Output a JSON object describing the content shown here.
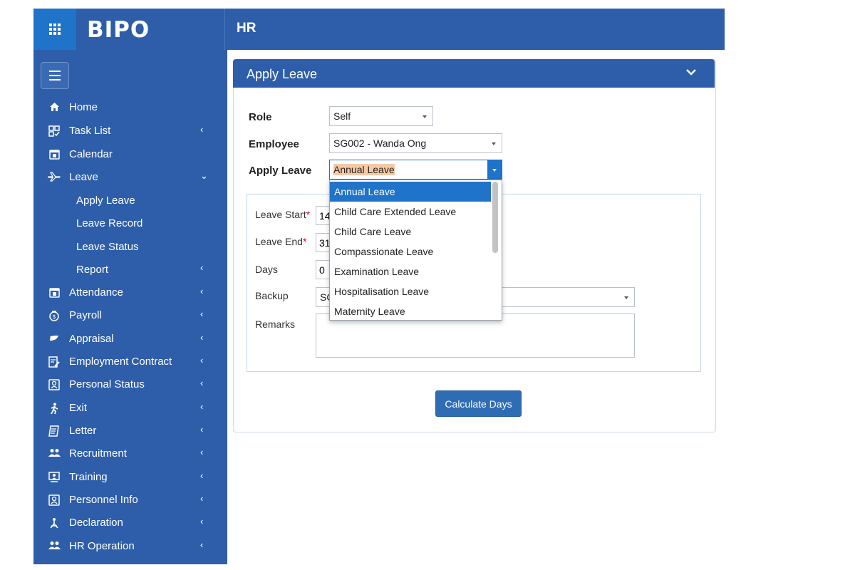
{
  "app": {
    "logo": "BIPO",
    "module": "HR"
  },
  "sidebar": {
    "items": [
      {
        "label": "Home",
        "icon": "home-icon",
        "chevron": ""
      },
      {
        "label": "Task List",
        "icon": "task-list-icon",
        "chevron": "‹"
      },
      {
        "label": "Calendar",
        "icon": "calendar-icon",
        "chevron": ""
      },
      {
        "label": "Leave",
        "icon": "plane-icon",
        "chevron": "⌄"
      },
      {
        "label": "Attendance",
        "icon": "calendar-icon",
        "chevron": "‹"
      },
      {
        "label": "Payroll",
        "icon": "payroll-icon",
        "chevron": "‹"
      },
      {
        "label": "Appraisal",
        "icon": "appraisal-icon",
        "chevron": "‹"
      },
      {
        "label": "Employment Contract",
        "icon": "contract-icon",
        "chevron": "‹"
      },
      {
        "label": "Personal Status",
        "icon": "id-card-icon",
        "chevron": "‹"
      },
      {
        "label": "Exit",
        "icon": "exit-icon",
        "chevron": "‹"
      },
      {
        "label": "Letter",
        "icon": "letter-icon",
        "chevron": "‹"
      },
      {
        "label": "Recruitment",
        "icon": "users-icon",
        "chevron": "‹"
      },
      {
        "label": "Training",
        "icon": "training-icon",
        "chevron": "‹"
      },
      {
        "label": "Personnel Info",
        "icon": "id-card-icon",
        "chevron": "‹"
      },
      {
        "label": "Declaration",
        "icon": "declaration-icon",
        "chevron": "‹"
      },
      {
        "label": "HR Operation",
        "icon": "users-icon",
        "chevron": "‹"
      }
    ],
    "leave_sub": [
      {
        "label": "Apply Leave"
      },
      {
        "label": "Leave Record"
      },
      {
        "label": "Leave Status"
      },
      {
        "label": "Report",
        "chevron": "‹"
      }
    ]
  },
  "panel": {
    "title": "Apply Leave",
    "role_label": "Role",
    "role_value": "Self",
    "employee_label": "Employee",
    "employee_value": "SG002 - Wanda Ong",
    "apply_label": "Apply Leave",
    "apply_value": "Annual Leave",
    "leave_start_label": "Leave Start",
    "leave_start_value": "14",
    "leave_end_label": "Leave End",
    "leave_end_value": "31",
    "required_mark": "*",
    "days_label": "Days",
    "days_value": "0",
    "backup_label": "Backup",
    "backup_value": "SG",
    "remarks_label": "Remarks",
    "calc_button": "Calculate Days"
  },
  "dropdown": {
    "options": [
      "Annual Leave",
      "Child Care Extended Leave",
      "Child Care Leave",
      "Compassionate Leave",
      "Examination Leave",
      "Hospitalisation Leave",
      "Maternity Leave"
    ],
    "selected": "Annual Leave"
  },
  "colors": {
    "primary": "#2e5ea9",
    "accent": "#1f73c9",
    "highlight": "#f6c9a4",
    "required": "#d0021b"
  }
}
